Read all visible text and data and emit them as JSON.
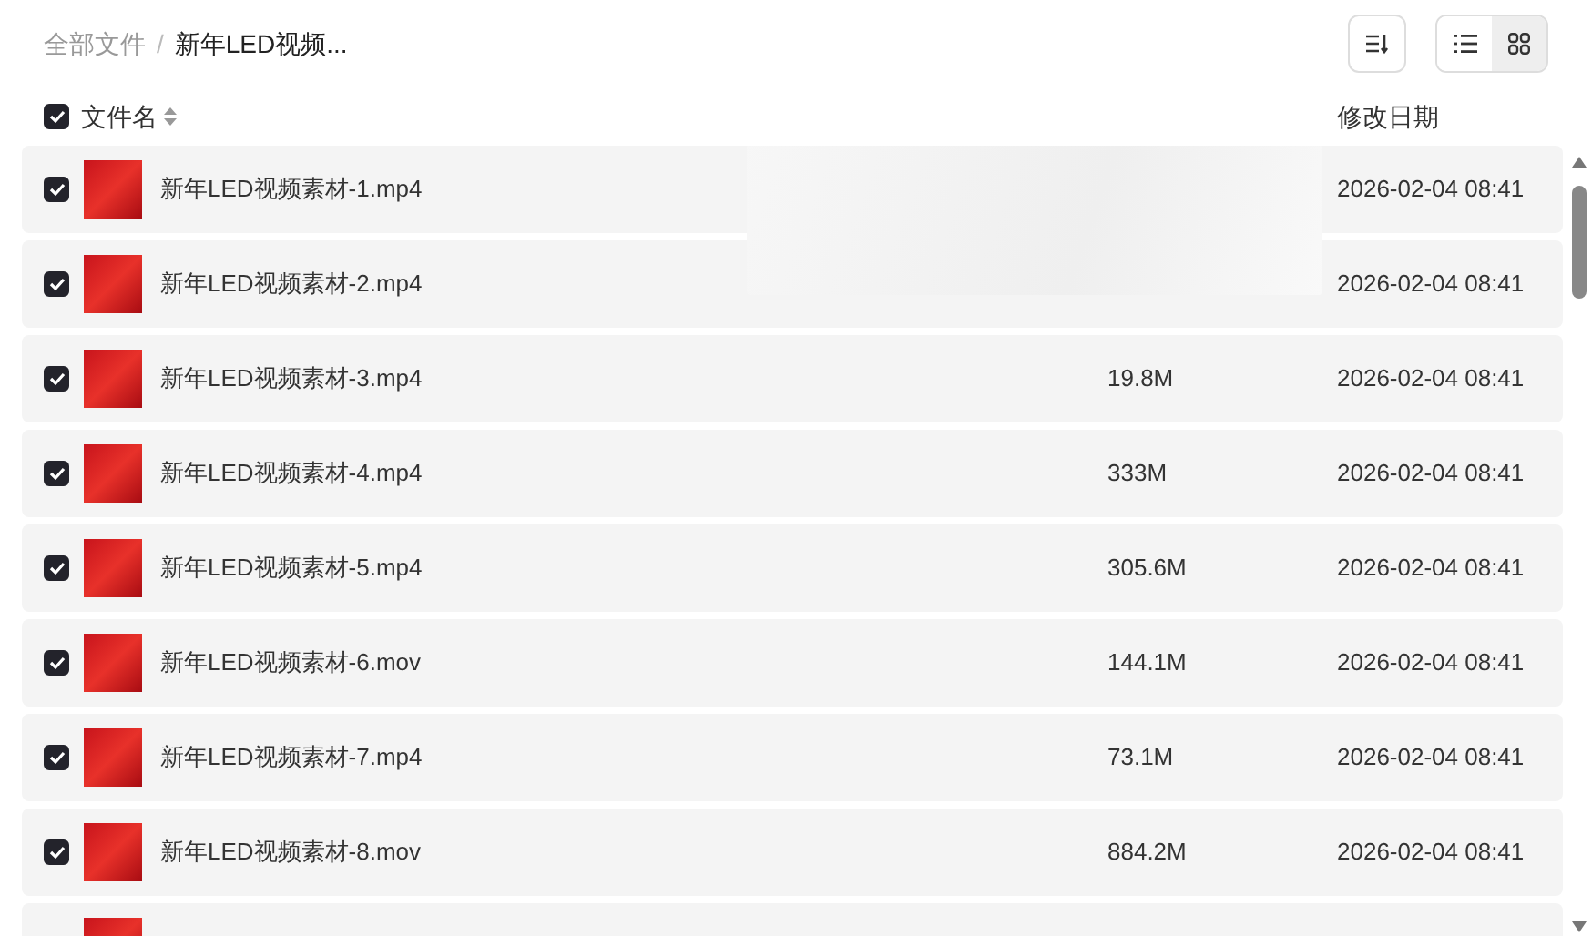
{
  "breadcrumb": [
    {
      "label": "全部文件",
      "current": false
    },
    {
      "label": "新年LED视频...",
      "current": true
    }
  ],
  "view_modes": [
    {
      "kind": "list",
      "selected": true
    },
    {
      "kind": "grid",
      "selected": false
    }
  ],
  "breadcrumb_separator": "/",
  "header": {
    "all_checked": true,
    "name": "文件名",
    "modified": "修改日期"
  },
  "rows": [
    {
      "checked": true,
      "name": "新年LED视频素材-1.mp4",
      "modified": "2026-02-04 08:41"
    },
    {
      "checked": true,
      "name": "新年LED视频素材-2.mp4",
      "modified": "2026-02-04 08:41"
    },
    {
      "checked": true,
      "name": "新年LED视频素材-3.mp4",
      "size": "19.8M",
      "modified": "2026-02-04 08:41"
    },
    {
      "checked": true,
      "name": "新年LED视频素材-4.mp4",
      "size": "333M",
      "modified": "2026-02-04 08:41"
    },
    {
      "checked": true,
      "name": "新年LED视频素材-5.mp4",
      "size": "305.6M",
      "modified": "2026-02-04 08:41"
    },
    {
      "checked": true,
      "name": "新年LED视频素材-6.mov",
      "size": "144.1M",
      "modified": "2026-02-04 08:41"
    },
    {
      "checked": true,
      "name": "新年LED视频素材-7.mp4",
      "size": "73.1M",
      "modified": "2026-02-04 08:41"
    },
    {
      "checked": true,
      "name": "新年LED视频素材-8.mov",
      "size": "884.2M",
      "modified": "2026-02-04 08:41"
    }
  ]
}
